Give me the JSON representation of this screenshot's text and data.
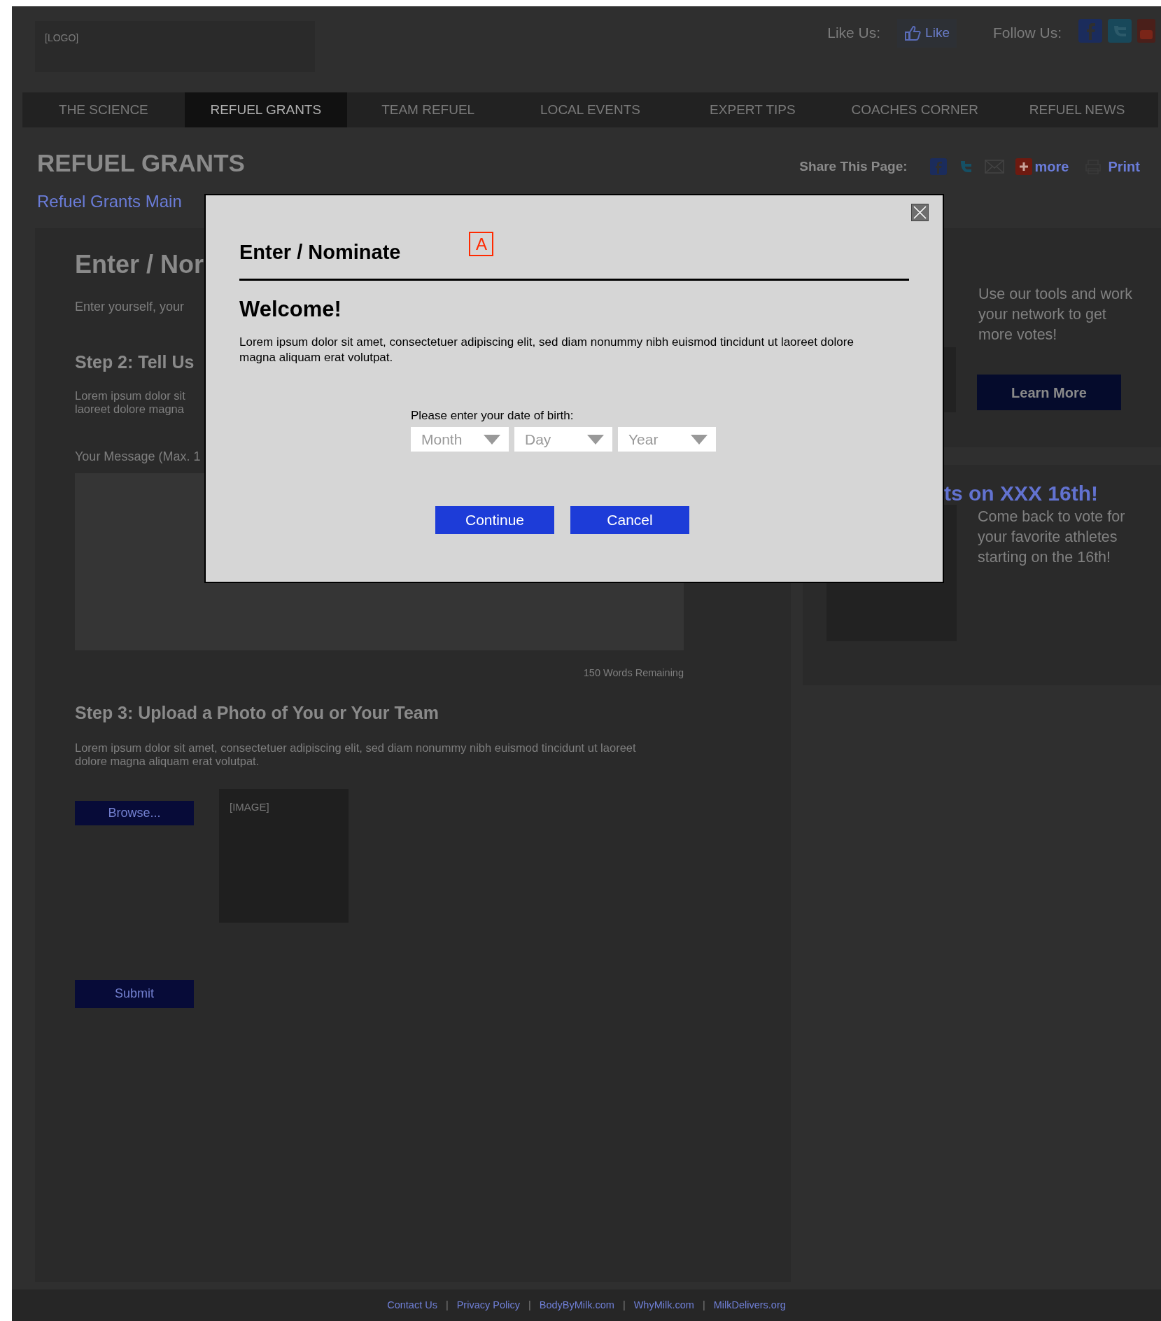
{
  "header": {
    "logo": "[LOGO]",
    "like_label": "Like Us:",
    "like_button": "Like",
    "follow_label": "Follow Us:"
  },
  "nav": [
    {
      "label": "THE SCIENCE",
      "selected": false
    },
    {
      "label": "REFUEL GRANTS",
      "selected": true
    },
    {
      "label": "TEAM REFUEL",
      "selected": false
    },
    {
      "label": "LOCAL EVENTS",
      "selected": false
    },
    {
      "label": "EXPERT TIPS",
      "selected": false
    },
    {
      "label": "COACHES CORNER",
      "selected": false
    },
    {
      "label": "REFUEL NEWS",
      "selected": false
    }
  ],
  "page_title": "REFUEL GRANTS",
  "share": {
    "label": "Share This Page:",
    "more": "more",
    "print": "Print"
  },
  "breadcrumb": "Refuel Grants Main",
  "form": {
    "title": "Enter / Nor",
    "intro": "Enter yourself, your",
    "step2_title": "Step 2: Tell Us",
    "step2_text": "Lorem ipsum dolor sit\nlaoreet dolore magna",
    "message_label": "Your Message (Max. 1",
    "words_remaining": "150 Words Remaining",
    "step3_title": "Step 3: Upload a Photo of You or Your Team",
    "step3_text": "Lorem ipsum dolor sit amet, consectetuer adipiscing elit, sed diam nonummy nibh euismod tincidunt ut laoreet dolore magna aliquam erat volutpat.",
    "browse_button": "Browse...",
    "image_placeholder": "[IMAGE]",
    "submit_button": "Submit"
  },
  "sidebar": [
    {
      "text": "Use our tools and work your network to get more votes!",
      "button": "Learn More"
    },
    {
      "heading": "ts on XXX 16th!",
      "text": "Come back to vote for your favorite athletes starting on the 16th!"
    }
  ],
  "dialog": {
    "title": "Enter / Nominate",
    "annotation_marker": "A",
    "heading": "Welcome!",
    "text": "Lorem ipsum dolor sit amet, consectetuer adipiscing elit, sed diam nonummy nibh euismod tincidunt ut laoreet dolore magna aliquam erat volutpat.",
    "dob_label": "Please enter your date of birth:",
    "selects": [
      {
        "placeholder": "Month"
      },
      {
        "placeholder": "Day"
      },
      {
        "placeholder": "Year"
      }
    ],
    "buttons": [
      "Continue",
      "Cancel"
    ]
  },
  "footer": {
    "separator": "|",
    "links": [
      "Contact Us",
      "Privacy Policy",
      "BodyByMilk.com",
      "WhyMilk.com",
      "MilkDelivers.org"
    ]
  }
}
